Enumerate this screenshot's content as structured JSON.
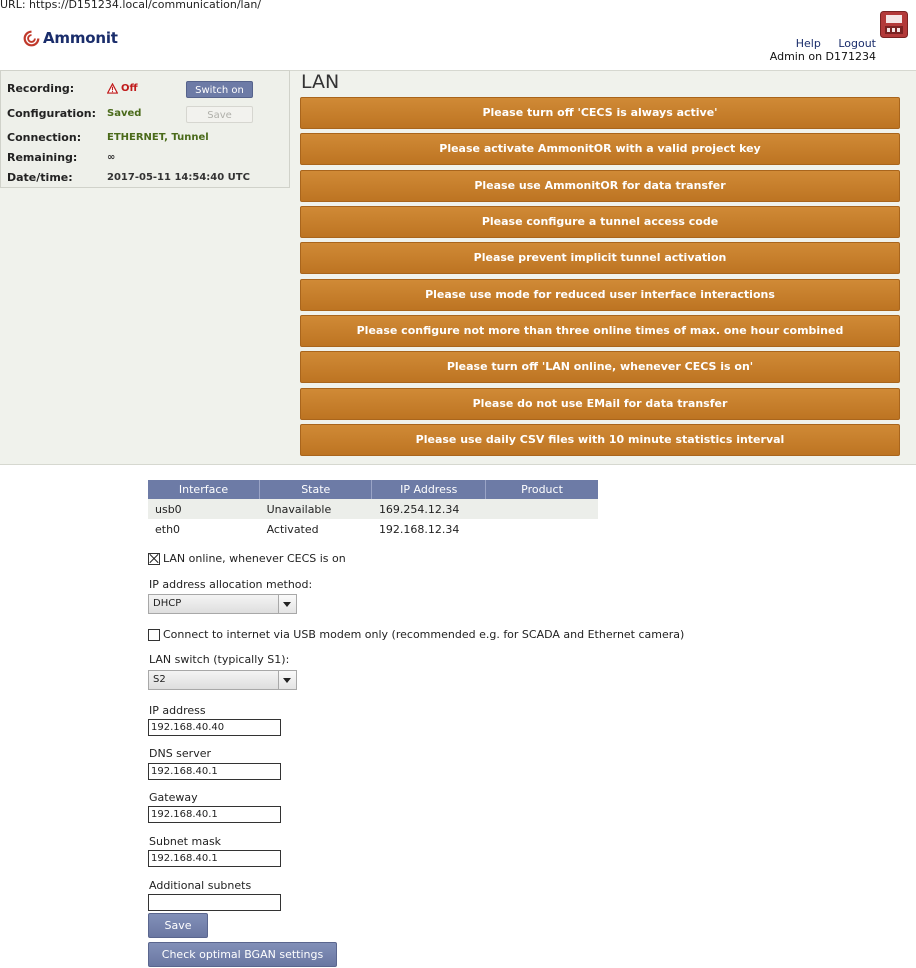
{
  "browser": {
    "url_label": "URL:",
    "url": "https://D151234.local/communication/lan/"
  },
  "brand": {
    "name": "Ammonit",
    "color": "#1a2d6b"
  },
  "top_links": {
    "help": "Help",
    "logout": "Logout",
    "user": "Admin on D171234"
  },
  "status": {
    "recording_label": "Recording:",
    "recording_value": "Off",
    "recording_icon": "warning-icon",
    "switch_on": "Switch on",
    "configuration_label": "Configuration:",
    "configuration_value": "Saved",
    "save": "Save",
    "connection_label": "Connection:",
    "connection_value": "ETHERNET, Tunnel",
    "remaining_label": "Remaining:",
    "remaining_value": "∞",
    "datetime_label": "Date/time:",
    "datetime_value": "2017-05-11 14:54:40 UTC"
  },
  "page_title": "LAN",
  "alerts": [
    "Please turn off 'CECS is always active'",
    "Please activate AmmonitOR with a valid project key",
    "Please use AmmonitOR for data transfer",
    "Please configure a tunnel access code",
    "Please prevent implicit tunnel activation",
    "Please use mode for reduced user interface interactions",
    "Please configure not more than three online times of max. one hour combined",
    "Please turn off 'LAN online, whenever CECS is on'",
    "Please do not use EMail for data transfer",
    "Please use daily CSV files with 10 minute statistics interval"
  ],
  "interfaces": {
    "headers": [
      "Interface",
      "State",
      "IP Address",
      "Product"
    ],
    "rows": [
      [
        "usb0",
        "Unavailable",
        "169.254.12.34",
        ""
      ],
      [
        "eth0",
        "Activated",
        "192.168.12.34",
        ""
      ]
    ]
  },
  "form": {
    "lan_online_label": "LAN online, whenever CECS is on",
    "lan_online_checked": true,
    "alloc_label": "IP address allocation method:",
    "alloc_value": "DHCP",
    "usb_only_label": "Connect to internet via USB modem only (recommended e.g. for SCADA and Ethernet camera)",
    "usb_only_checked": false,
    "lan_switch_label": "LAN switch (typically S1):",
    "lan_switch_value": "S2",
    "ip_label": "IP address",
    "ip_value": "192.168.40.40",
    "dns_label": "DNS server",
    "dns_value": "192.168.40.1",
    "gateway_label": "Gateway",
    "gateway_value": "192.168.40.1",
    "subnet_label": "Subnet mask",
    "subnet_value": "192.168.40.1",
    "additional_label": "Additional subnets",
    "additional_value": "",
    "save": "Save",
    "bgan": "Check optimal BGAN settings"
  },
  "colors": {
    "alert": "#c47d2a",
    "button": "#6d7ba6",
    "off": "#c01a1a",
    "ok": "#4a6a1a"
  }
}
